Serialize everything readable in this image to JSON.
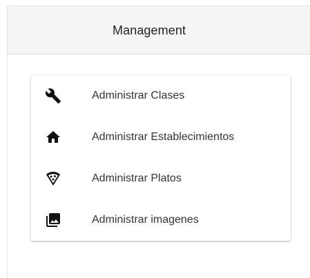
{
  "header": {
    "title": "Management"
  },
  "menu": {
    "items": [
      {
        "label": "Administrar Clases",
        "icon": "wrench-icon"
      },
      {
        "label": "Administrar Establecimientos",
        "icon": "home-icon"
      },
      {
        "label": "Administrar Platos",
        "icon": "pizza-icon"
      },
      {
        "label": "Administrar imagenes",
        "icon": "image-icon"
      }
    ]
  },
  "colors": {
    "header_bg": "#f5f5f5",
    "text": "#333333",
    "icon": "#111111"
  }
}
